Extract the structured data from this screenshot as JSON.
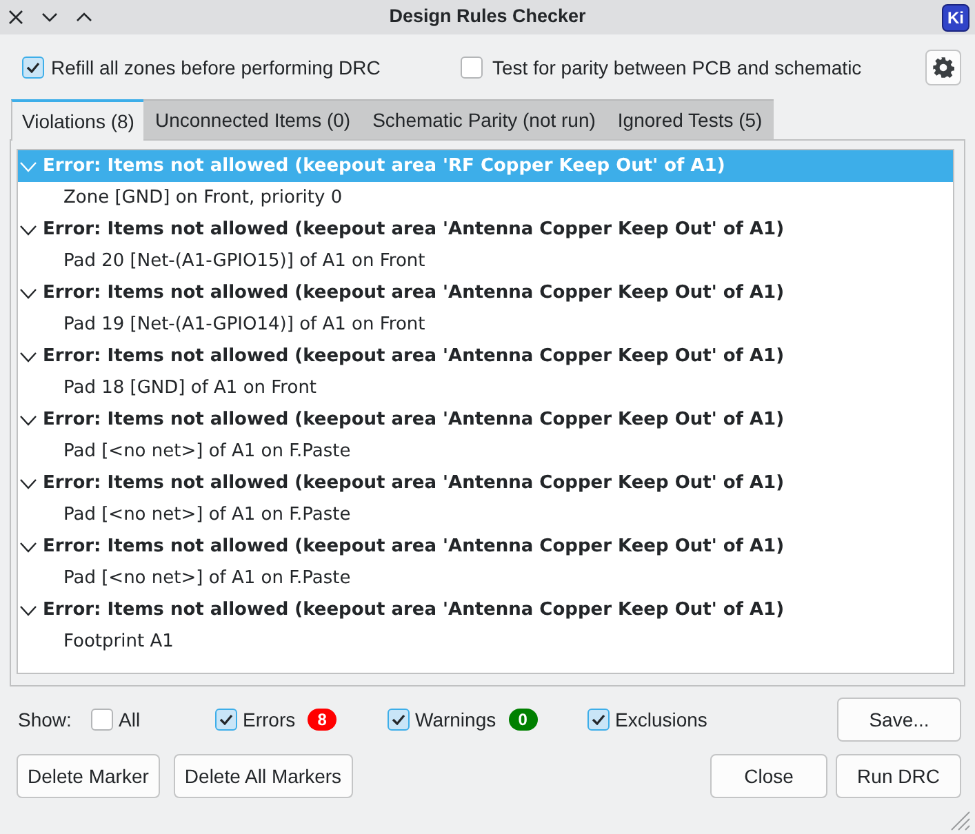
{
  "window": {
    "title": "Design Rules Checker",
    "logo": "Ki"
  },
  "options": [
    {
      "label": "Refill all zones before performing DRC",
      "checked": true
    },
    {
      "label": "Test for parity between PCB and schematic",
      "checked": false
    }
  ],
  "tabs": [
    {
      "label": "Violations (8)",
      "selected": true
    },
    {
      "label": "Unconnected Items (0)",
      "selected": false
    },
    {
      "label": "Schematic Parity (not run)",
      "selected": false
    },
    {
      "label": "Ignored Tests (5)",
      "selected": false
    }
  ],
  "violations": [
    {
      "title": "Error: Items not allowed (keepout area 'RF Copper Keep Out' of A1)",
      "expanded": true,
      "selected": true,
      "children": [
        {
          "label": "Zone [GND] on Front, priority 0",
          "selected": false
        }
      ]
    },
    {
      "title": "Error: Items not allowed (keepout area 'Antenna Copper Keep Out' of A1)",
      "expanded": true,
      "selected": false,
      "children": [
        {
          "label": "Pad 20 [Net-(A1-GPIO15)] of A1 on Front",
          "selected": false
        }
      ]
    },
    {
      "title": "Error: Items not allowed (keepout area 'Antenna Copper Keep Out' of A1)",
      "expanded": true,
      "selected": false,
      "children": [
        {
          "label": "Pad 19 [Net-(A1-GPIO14)] of A1 on Front",
          "selected": false
        }
      ]
    },
    {
      "title": "Error: Items not allowed (keepout area 'Antenna Copper Keep Out' of A1)",
      "expanded": true,
      "selected": false,
      "children": [
        {
          "label": "Pad 18 [GND] of A1 on Front",
          "selected": false
        }
      ]
    },
    {
      "title": "Error: Items not allowed (keepout area 'Antenna Copper Keep Out' of A1)",
      "expanded": true,
      "selected": false,
      "children": [
        {
          "label": "Pad [<no net>] of A1 on F.Paste",
          "selected": false
        }
      ]
    },
    {
      "title": "Error: Items not allowed (keepout area 'Antenna Copper Keep Out' of A1)",
      "expanded": true,
      "selected": false,
      "children": [
        {
          "label": "Pad [<no net>] of A1 on F.Paste",
          "selected": false
        }
      ]
    },
    {
      "title": "Error: Items not allowed (keepout area 'Antenna Copper Keep Out' of A1)",
      "expanded": true,
      "selected": false,
      "children": [
        {
          "label": "Pad [<no net>] of A1 on F.Paste",
          "selected": false
        }
      ]
    },
    {
      "title": "Error: Items not allowed (keepout area 'Antenna Copper Keep Out' of A1)",
      "expanded": true,
      "selected": false,
      "children": [
        {
          "label": "Footprint A1",
          "selected": false
        }
      ]
    }
  ],
  "show": {
    "label": "Show:",
    "filters": [
      {
        "label": "All",
        "checked": false
      },
      {
        "label": "Errors",
        "checked": true,
        "badge": "8",
        "color": "#ff0000"
      },
      {
        "label": "Warnings",
        "checked": true,
        "badge": "0",
        "color": "#008000"
      },
      {
        "label": "Exclusions",
        "checked": true
      }
    ]
  },
  "save_button": "Save...",
  "marker_buttons": [
    "Delete Marker",
    "Delete All Markers"
  ],
  "dialog_buttons": [
    "Close",
    "Run DRC"
  ]
}
